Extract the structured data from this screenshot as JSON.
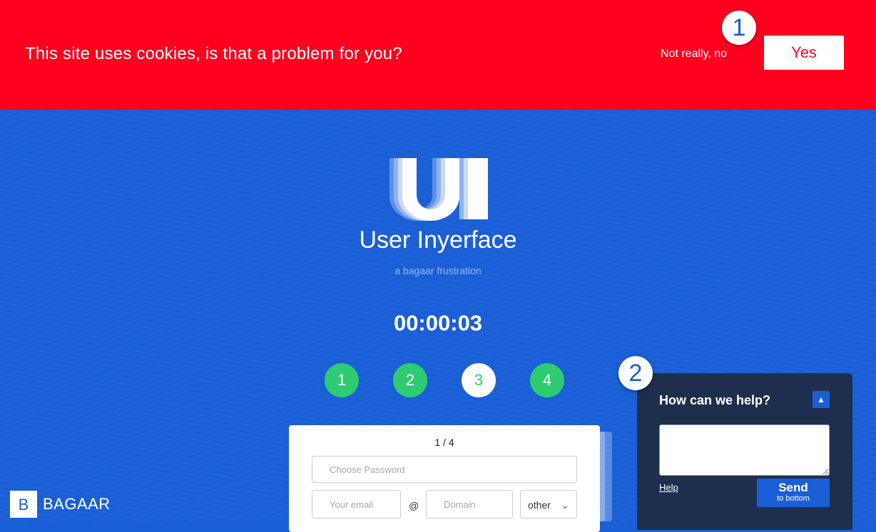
{
  "cookie_banner": {
    "text": "This site uses cookies, is that a problem for you?",
    "decline_label": "Not really, no",
    "accept_label": "Yes",
    "color": "#ff001f"
  },
  "markers": {
    "first": "1",
    "second": "2"
  },
  "brand": {
    "logo_letters": "UI",
    "title": "User Inyerface",
    "subtitle": "a bagaar frustration",
    "background": "#1a5fd6"
  },
  "timer": "00:00:03",
  "steps": [
    {
      "label": "1",
      "state": "done"
    },
    {
      "label": "2",
      "state": "done"
    },
    {
      "label": "3",
      "state": "current"
    },
    {
      "label": "4",
      "state": "done"
    }
  ],
  "form": {
    "counter": "1 / 4",
    "password_placeholder": "Choose Password",
    "email_placeholder": "Your email",
    "at_sign": "@",
    "domain_placeholder": "Domain",
    "tld_value": "other"
  },
  "help": {
    "title": "How can we help?",
    "link_label": "Help",
    "send_label": "Send",
    "send_sublabel": "to bottom",
    "color": "#1d2f4d"
  },
  "footer": {
    "logo_letter": "B",
    "name": "BAGAAR"
  }
}
